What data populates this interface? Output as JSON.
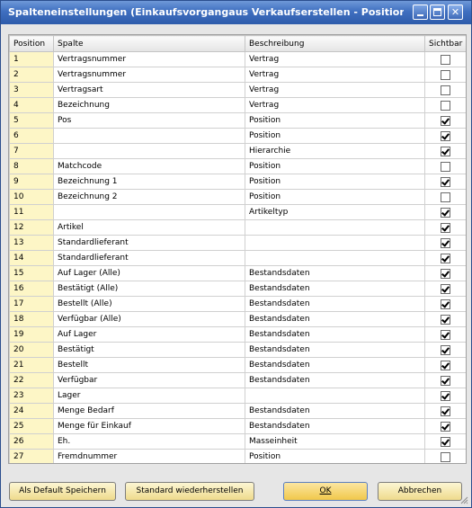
{
  "window": {
    "title": "Spalteneinstellungen (Einkaufsvorgangaus Verkaufserstellen - Positionsausw..."
  },
  "table": {
    "headers": [
      "Position",
      "Spalte",
      "Beschreibung",
      "Sichtbar"
    ],
    "rows": [
      {
        "pos": "1",
        "col": "Vertragsnummer",
        "desc": "Vertrag",
        "vis": false
      },
      {
        "pos": "2",
        "col": "Vertragsnummer",
        "desc": "Vertrag",
        "vis": false
      },
      {
        "pos": "3",
        "col": "Vertragsart",
        "desc": "Vertrag",
        "vis": false
      },
      {
        "pos": "4",
        "col": "Bezeichnung",
        "desc": "Vertrag",
        "vis": false
      },
      {
        "pos": "5",
        "col": "Pos",
        "desc": "Position",
        "vis": true
      },
      {
        "pos": "6",
        "col": "",
        "desc": "Position",
        "vis": true
      },
      {
        "pos": "7",
        "col": "",
        "desc": "Hierarchie",
        "vis": true
      },
      {
        "pos": "8",
        "col": "Matchcode",
        "desc": "Position",
        "vis": false
      },
      {
        "pos": "9",
        "col": "Bezeichnung 1",
        "desc": "Position",
        "vis": true
      },
      {
        "pos": "10",
        "col": "Bezeichnung 2",
        "desc": "Position",
        "vis": false
      },
      {
        "pos": "11",
        "col": "",
        "desc": "Artikeltyp",
        "vis": true
      },
      {
        "pos": "12",
        "col": "Artikel",
        "desc": "",
        "vis": true
      },
      {
        "pos": "13",
        "col": "Standardlieferant",
        "desc": "",
        "vis": true
      },
      {
        "pos": "14",
        "col": "Standardlieferant",
        "desc": "",
        "vis": true
      },
      {
        "pos": "15",
        "col": "Auf Lager (Alle)",
        "desc": "Bestandsdaten",
        "vis": true
      },
      {
        "pos": "16",
        "col": "Bestätigt (Alle)",
        "desc": "Bestandsdaten",
        "vis": true
      },
      {
        "pos": "17",
        "col": "Bestellt (Alle)",
        "desc": "Bestandsdaten",
        "vis": true
      },
      {
        "pos": "18",
        "col": "Verfügbar (Alle)",
        "desc": "Bestandsdaten",
        "vis": true
      },
      {
        "pos": "19",
        "col": "Auf Lager",
        "desc": "Bestandsdaten",
        "vis": true
      },
      {
        "pos": "20",
        "col": "Bestätigt",
        "desc": "Bestandsdaten",
        "vis": true
      },
      {
        "pos": "21",
        "col": "Bestellt",
        "desc": "Bestandsdaten",
        "vis": true
      },
      {
        "pos": "22",
        "col": "Verfügbar",
        "desc": "Bestandsdaten",
        "vis": true
      },
      {
        "pos": "23",
        "col": "Lager",
        "desc": "",
        "vis": true
      },
      {
        "pos": "24",
        "col": "Menge Bedarf",
        "desc": "Bestandsdaten",
        "vis": true
      },
      {
        "pos": "25",
        "col": "Menge für Einkauf",
        "desc": "Bestandsdaten",
        "vis": true
      },
      {
        "pos": "26",
        "col": "Eh.",
        "desc": "Masseinheit",
        "vis": true
      },
      {
        "pos": "27",
        "col": "Fremdnummer",
        "desc": "Position",
        "vis": false
      }
    ]
  },
  "buttons": {
    "default_save": "Als Default Speichern",
    "restore": "Standard wiederherstellen",
    "ok": "OK",
    "cancel": "Abbrechen"
  },
  "icons": {
    "minimize": "minimize-icon",
    "maximize": "maximize-icon",
    "close": "close-icon",
    "resize": "resize-grip-icon"
  }
}
